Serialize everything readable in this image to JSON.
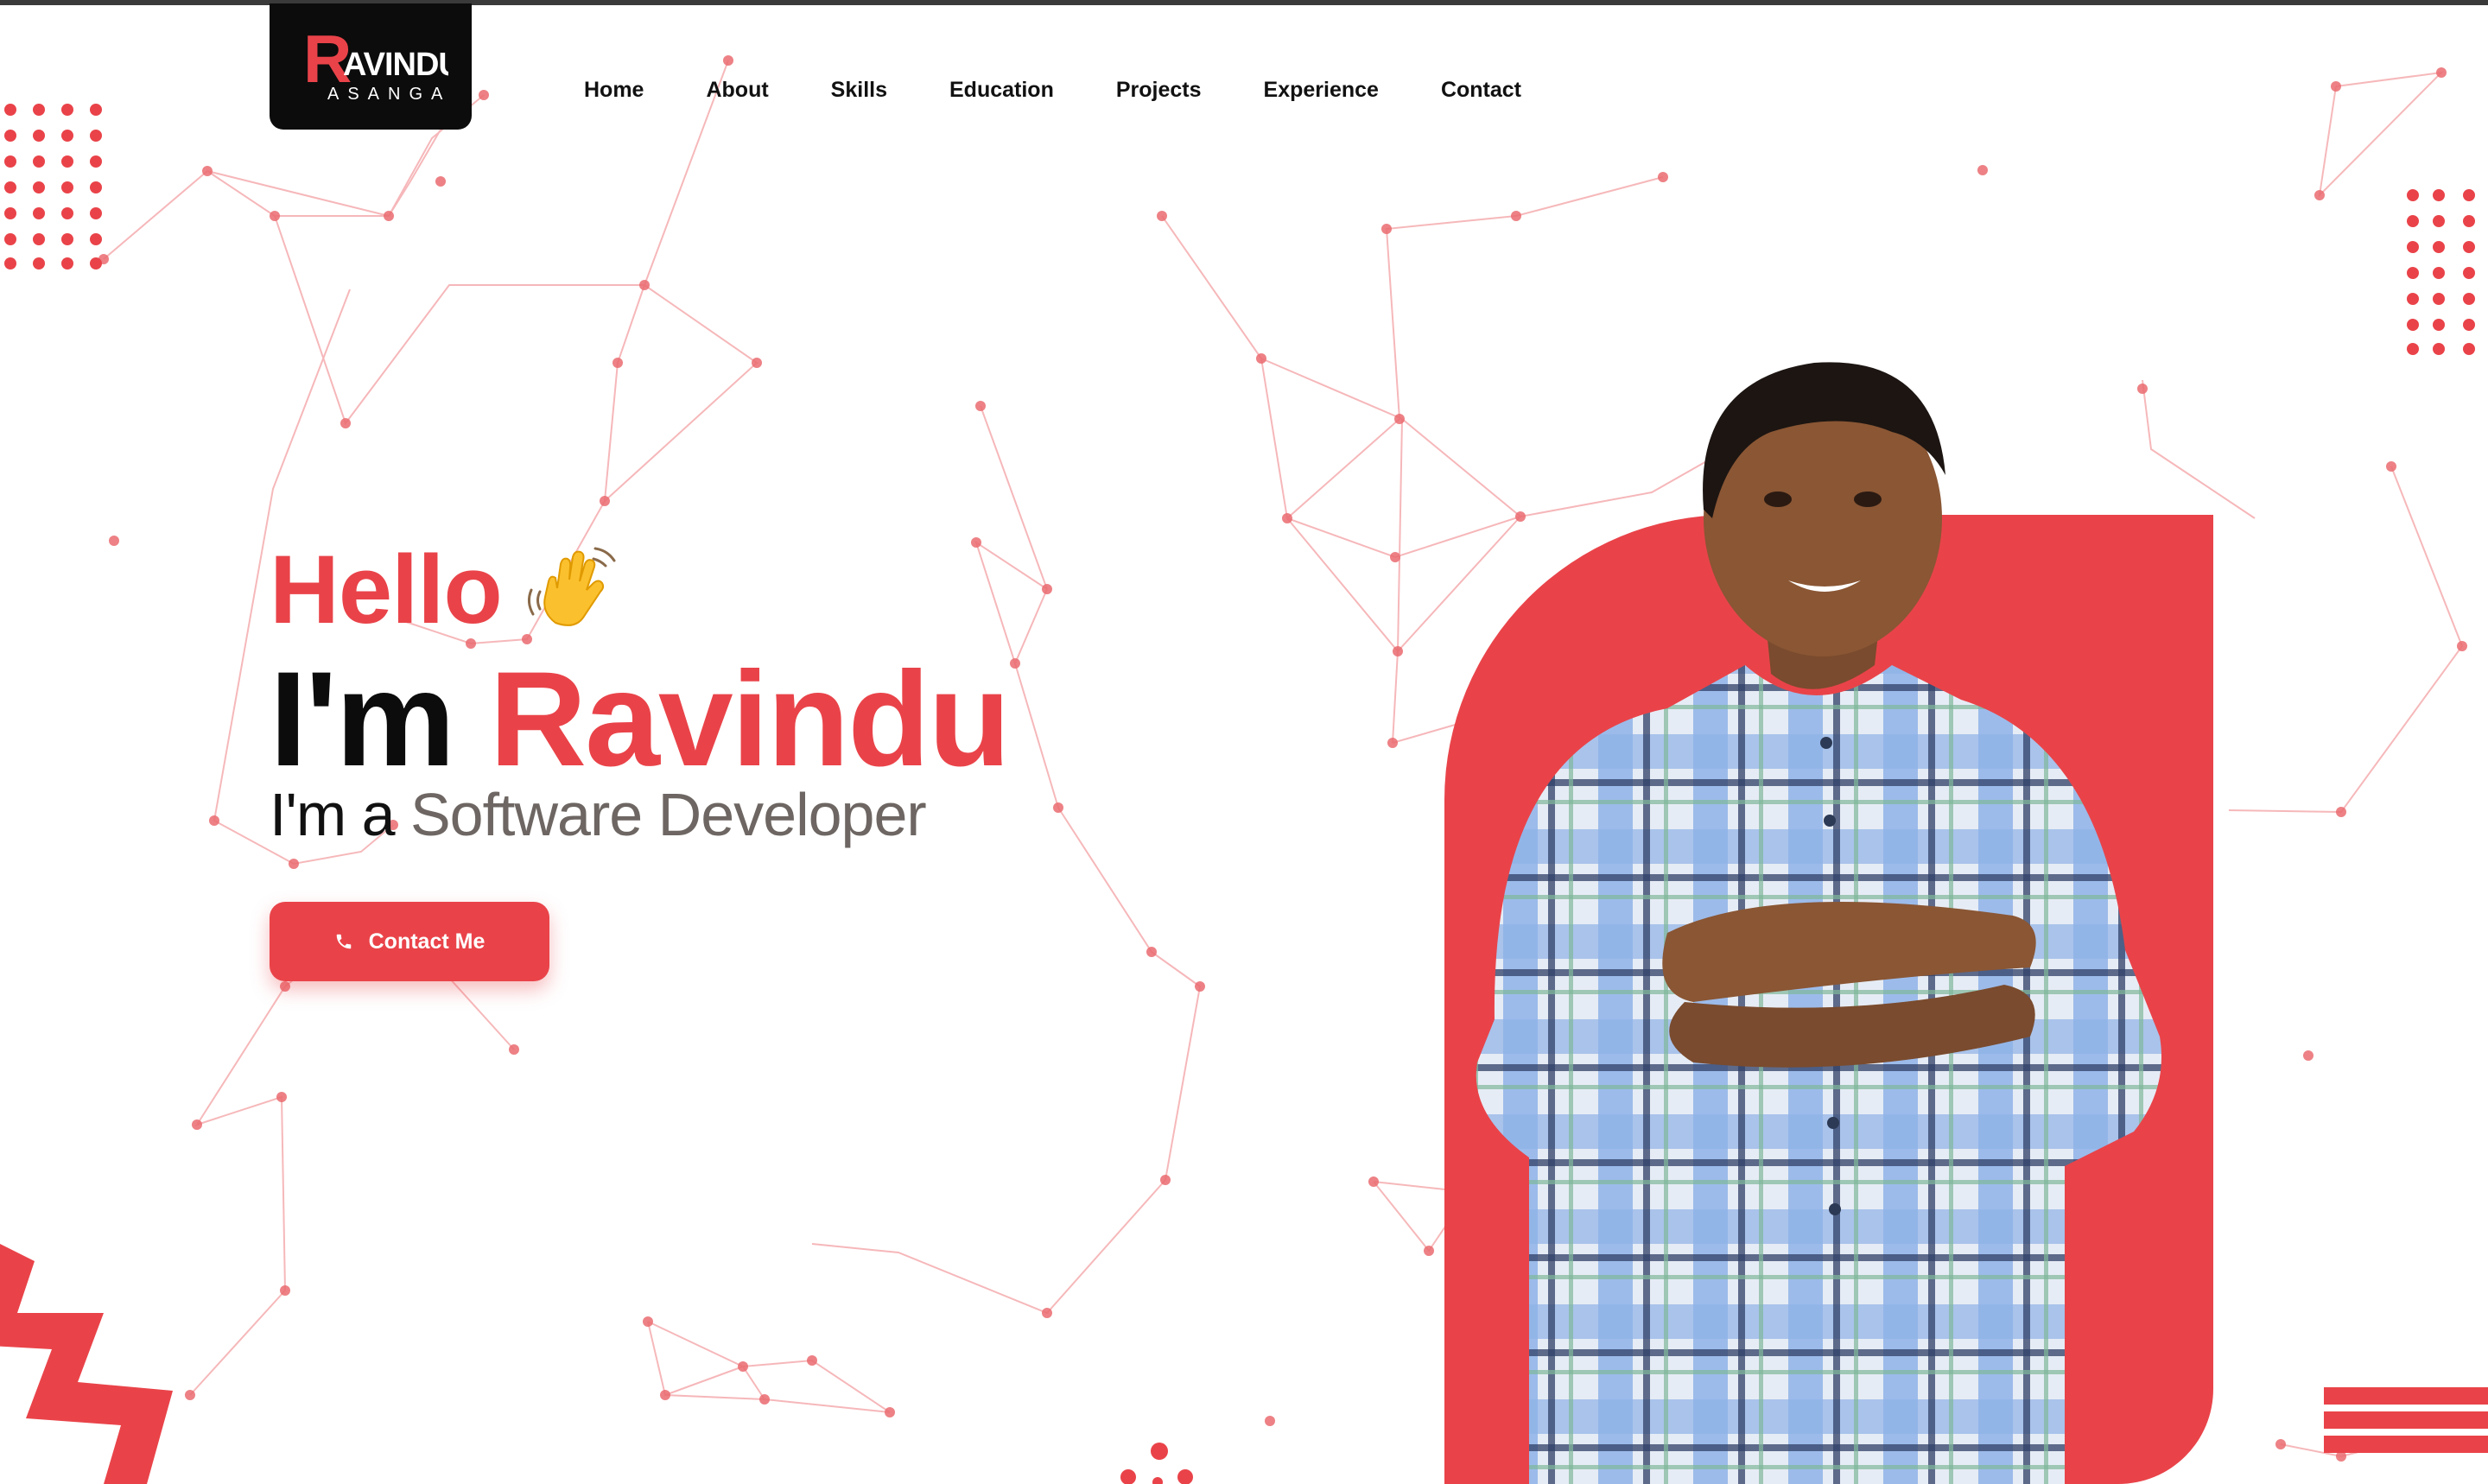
{
  "brand": {
    "logo_line1": "AVINDU",
    "logo_initial": "R",
    "logo_line2": "ASANGA"
  },
  "nav": {
    "items": [
      {
        "label": "Home"
      },
      {
        "label": "About"
      },
      {
        "label": "Skills"
      },
      {
        "label": "Education"
      },
      {
        "label": "Projects"
      },
      {
        "label": "Experience"
      },
      {
        "label": "Contact"
      }
    ]
  },
  "hero": {
    "greeting": "Hello",
    "greeting_icon": "waving-hand-icon",
    "intro_prefix": "I'm",
    "name": "Ravindu",
    "role_prefix": "I'm a",
    "role": "Software Developer",
    "cta_label": "Contact Me",
    "cta_icon": "phone-icon"
  },
  "colors": {
    "accent": "#e94349",
    "text_dark": "#0c0c0c",
    "role_gray": "#6d6662",
    "logo_bg": "#0c0c0c"
  }
}
